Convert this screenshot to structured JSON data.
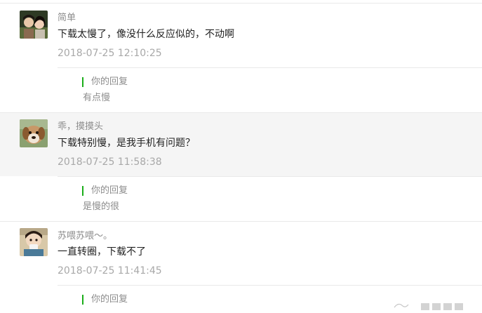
{
  "comments": [
    {
      "nickname": "简单",
      "text": "下载太慢了，像没什么反应似的，不动啊",
      "time": "2018-07-25 12:10:25",
      "reply_label": "你的回复",
      "reply_text": "有点慢"
    },
    {
      "nickname": "乖，摸摸头",
      "text": "下载特别慢，是我手机有问题？",
      "time": "2018-07-25 11:58:38",
      "reply_label": "你的回复",
      "reply_text": "是慢的很"
    },
    {
      "nickname": "苏喂苏喂～。",
      "text": "一直转圈，下载不了",
      "time": "2018-07-25 11:41:45",
      "reply_label": "你的回复"
    }
  ]
}
